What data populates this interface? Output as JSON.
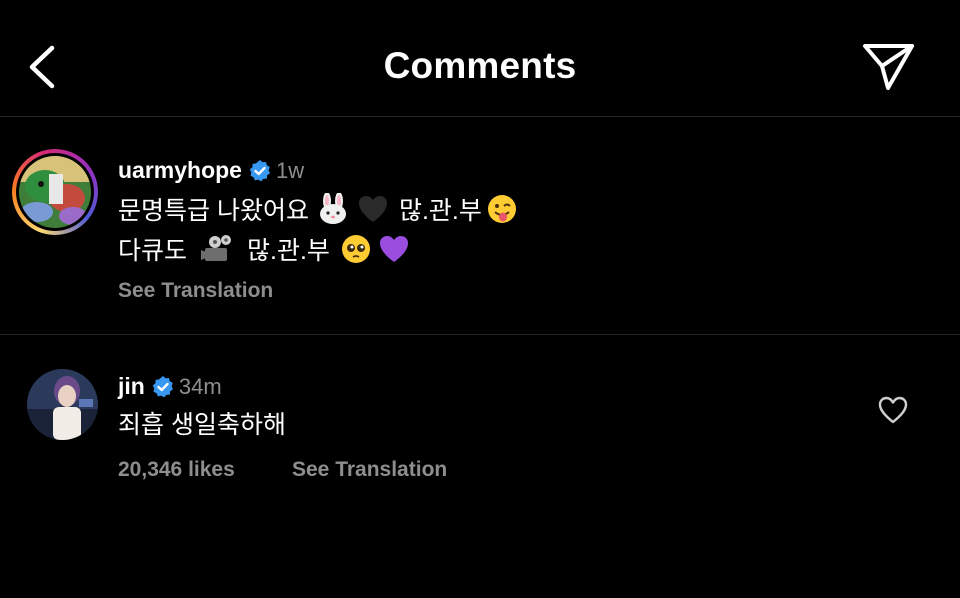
{
  "header": {
    "title": "Comments",
    "back_icon": "chevron-left-icon",
    "share_icon": "paper-plane-icon"
  },
  "caption": {
    "username": "uarmyhope",
    "verified": true,
    "time": "1w",
    "line1": "문명특급 나왔어요",
    "line1_suffix": "많.관.부",
    "line2": "다큐도",
    "line2_suffix": "많.관.부",
    "see_translation": "See Translation"
  },
  "comment": {
    "username": "jin",
    "verified": true,
    "time": "34m",
    "text": "죄흡 생일축하해",
    "likes": "20,346 likes",
    "see_translation": "See Translation",
    "like_icon": "heart-outline-icon"
  },
  "colors": {
    "background": "#000000",
    "text": "#ffffff",
    "secondary": "#8e8e8e",
    "verified": "#3897f0",
    "divider": "#262626"
  }
}
